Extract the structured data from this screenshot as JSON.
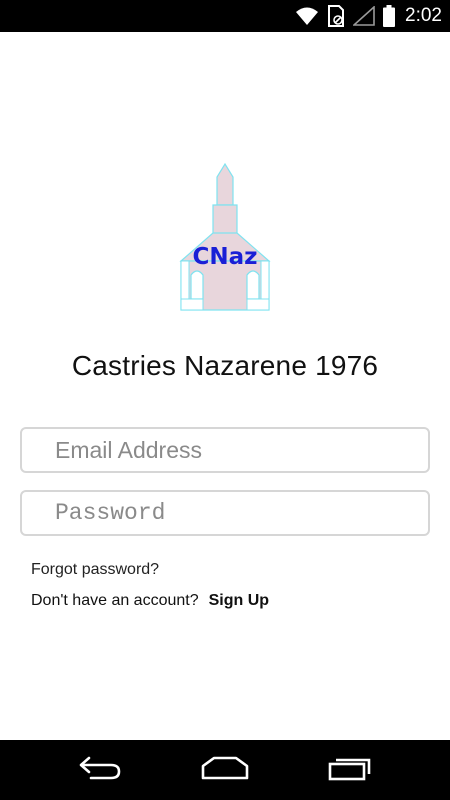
{
  "status_bar": {
    "time": "2:02",
    "icons": [
      "wifi-icon",
      "sim-icon",
      "signal-icon",
      "battery-icon"
    ]
  },
  "logo": {
    "text": "CNaz",
    "colors": {
      "outline": "#7fe3f0",
      "fill": "#e8d6dc",
      "text": "#1a1fd6"
    }
  },
  "app_title": "Castries Nazarene 1976",
  "form": {
    "email_placeholder": "Email Address",
    "email_value": "",
    "password_placeholder": "Password",
    "password_value": ""
  },
  "links": {
    "forgot_password": "Forgot password?",
    "no_account": "Don't have an account?",
    "sign_up": "Sign Up"
  },
  "nav_bar": {
    "buttons": [
      "back-icon",
      "home-icon",
      "recents-icon"
    ]
  },
  "colors": {
    "background": "#ffffff",
    "system_bars": "#000000",
    "field_border": "#d6d6d6",
    "placeholder": "#8a8a8a"
  }
}
